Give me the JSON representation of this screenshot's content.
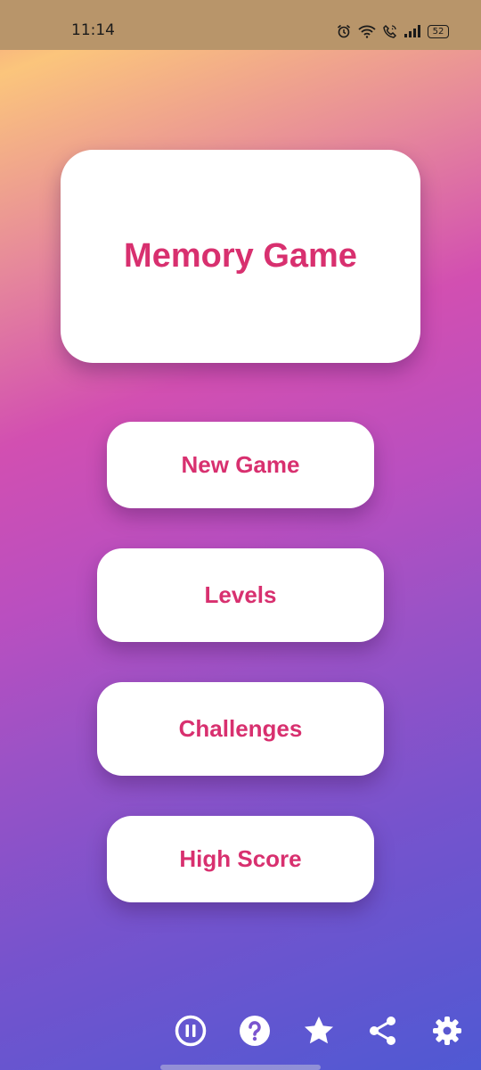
{
  "status_bar": {
    "time": "11:14",
    "battery": "52",
    "icons": [
      "alarm-icon",
      "wifi-icon",
      "call-icon",
      "signal-icon",
      "battery-icon"
    ]
  },
  "title": "Memory Game",
  "menu": {
    "new_game": "New Game",
    "levels": "Levels",
    "challenges": "Challenges",
    "high_score": "High Score"
  },
  "toolbar": {
    "icons": [
      "pause-icon",
      "help-icon",
      "star-icon",
      "share-icon",
      "settings-icon"
    ]
  },
  "colors": {
    "accent": "#d8306f",
    "card": "#ffffff",
    "status_bar": "#b8956a"
  }
}
